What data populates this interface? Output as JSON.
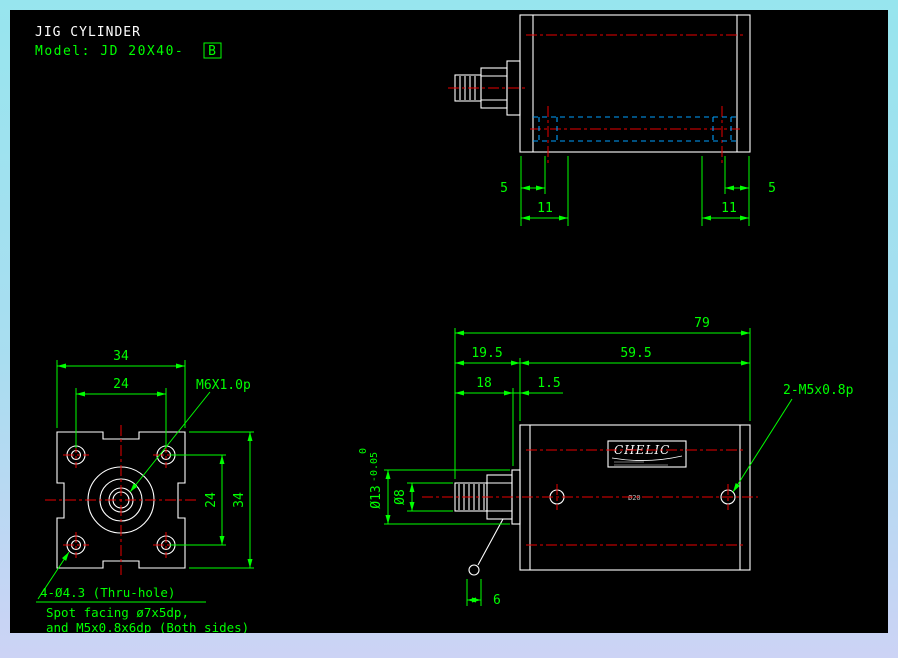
{
  "header": {
    "title": "JIG CYLINDER",
    "model_label": "Model: JD 20X40-",
    "model_option": "B"
  },
  "colors": {
    "canvas": "#000000",
    "outline": "#ffffff",
    "dimension": "#00ff00",
    "centerline": "#e80000",
    "hidden_line": "#00a0ff"
  },
  "top_view": {
    "dims": {
      "left_5": "5",
      "left_11": "11",
      "right_11": "11",
      "right_5": "5"
    }
  },
  "front_view": {
    "dims": {
      "width": "34",
      "bolt_spacing": "24",
      "bolt_spacing_v": "24",
      "height": "34"
    },
    "labels": {
      "rod_thread": "M6X1.0p"
    },
    "notes": [
      "4-Ø4.3 (Thru-hole)",
      "Spot facing ø7x5dp,",
      "and M5x0.8x6dp (Both sides)"
    ]
  },
  "side_view": {
    "dims": {
      "total_length": "79",
      "rod_length": "19.5",
      "body_length": "59.5",
      "rod_exposed": "18",
      "boss_step": "1.5",
      "boss_dia": "Ø13",
      "tol_upper": "0",
      "tol_lower": "-0.05",
      "rod_dia": "Ø8",
      "flat_width": "6"
    },
    "labels": {
      "ports": "2-M5x0.8p",
      "brand": "CHELIC",
      "bore": "Ø20"
    }
  }
}
